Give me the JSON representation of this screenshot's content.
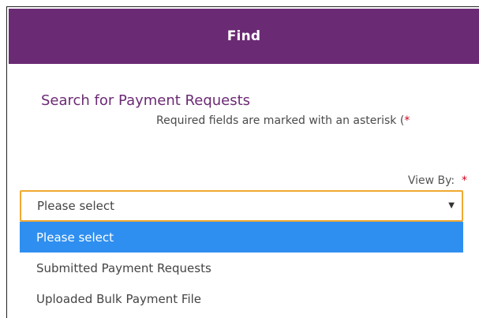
{
  "header": {
    "title": "Find"
  },
  "section": {
    "title": "Search for Payment Requests",
    "required_note": "Required fields are marked with an asterisk (",
    "required_mark": "*"
  },
  "view_by": {
    "label": "View By:",
    "required_mark": "*",
    "selected_value": "Please select",
    "options": [
      "Please select",
      "Submitted Payment Requests",
      "Uploaded Bulk Payment File"
    ]
  },
  "colors": {
    "header_bg": "#6b2a74",
    "accent_purple": "#6b2a74",
    "select_border": "#f0a830",
    "highlight": "#2f8ff0",
    "required": "#d0021b"
  },
  "icons": {
    "select_arrow": "caret-down-icon"
  }
}
